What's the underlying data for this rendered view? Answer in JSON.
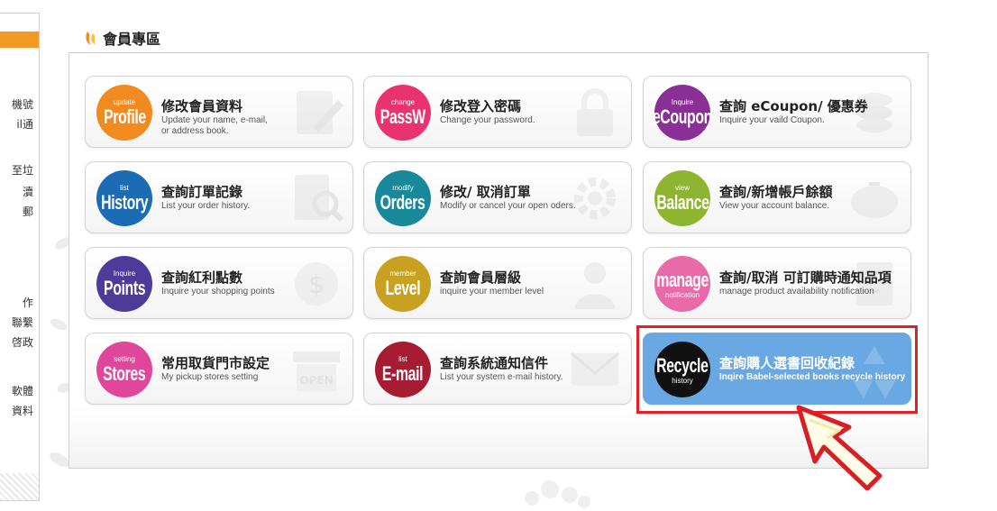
{
  "sidebar": {
    "fragments": [
      "機號",
      "il通",
      "至垃",
      "瀆",
      "郵",
      "作",
      "聯繫",
      "啓政",
      "軟體",
      "資料"
    ]
  },
  "section_title": "會員專區",
  "colors": {
    "orange": "#f18a1f",
    "pink": "#e8336f",
    "purple": "#8a2f95",
    "blue": "#1b6bb5",
    "teal": "#17899a",
    "green": "#8db530",
    "indigo": "#4c3b99",
    "mustard": "#c7a11f",
    "magenta": "#e86aa8",
    "hotpink": "#e0479a",
    "darkred": "#a71c33",
    "black": "#111111",
    "active_card": "#6aa8e4",
    "highlight": "#e32024"
  },
  "cards": [
    {
      "small": "update",
      "big": "Profile",
      "title": "修改會員資料",
      "sub": "Update your name, e-mail,\nor address book.",
      "color": "orange",
      "icon": "edit-icon"
    },
    {
      "small": "change",
      "big": "PassW",
      "title": "修改登入密碼",
      "sub": "Change your password.",
      "color": "pink",
      "icon": "lock-icon"
    },
    {
      "small": "Inquire",
      "big": "eCoupon",
      "title": "查詢 eCoupon/ 優惠券",
      "sub": "Inquire your vaild Coupon.",
      "color": "purple",
      "icon": "coins-icon"
    },
    {
      "small": "list",
      "big": "History",
      "title": "查詢訂單記錄",
      "sub": "List your order history.",
      "color": "blue",
      "icon": "document-search-icon"
    },
    {
      "small": "modify",
      "big": "Orders",
      "title": "修改/ 取消訂單",
      "sub": "Modify or cancel your open oders.",
      "color": "teal",
      "icon": "gear-icon"
    },
    {
      "small": "view",
      "big": "Balance",
      "title": "查詢/新增帳戶餘額",
      "sub": "View your account balance.",
      "color": "green",
      "icon": "piggy-bank-icon"
    },
    {
      "small": "Inquire",
      "big": "Points",
      "title": "查詢紅利點數",
      "sub": "Inquire your shopping points",
      "color": "indigo",
      "icon": "dollar-coin-icon"
    },
    {
      "small": "member",
      "big": "Level",
      "title": "查詢會員層級",
      "sub": "inquire your member level",
      "color": "mustard",
      "icon": "person-icon"
    },
    {
      "small": "notification",
      "big": "manage",
      "title": "查詢/取消 可訂購時通知品項",
      "sub": "manage product availability notification",
      "color": "magenta",
      "icon": "bell-list-icon"
    },
    {
      "small": "setting",
      "big": "Stores",
      "title": "常用取貨門市設定",
      "sub": "My pickup stores setting",
      "color": "hotpink",
      "icon": "store-icon"
    },
    {
      "small": "list",
      "big": "E-mail",
      "title": "查詢系統通知信件",
      "sub": "List your system e-mail history.",
      "color": "darkred",
      "icon": "envelope-icon"
    },
    {
      "small": "history",
      "big": "Recycle",
      "title": "查詢購人選書回收紀錄",
      "sub": "Inqire Babel-selected books recycle history",
      "color": "black",
      "icon": "recycle-icon"
    }
  ]
}
